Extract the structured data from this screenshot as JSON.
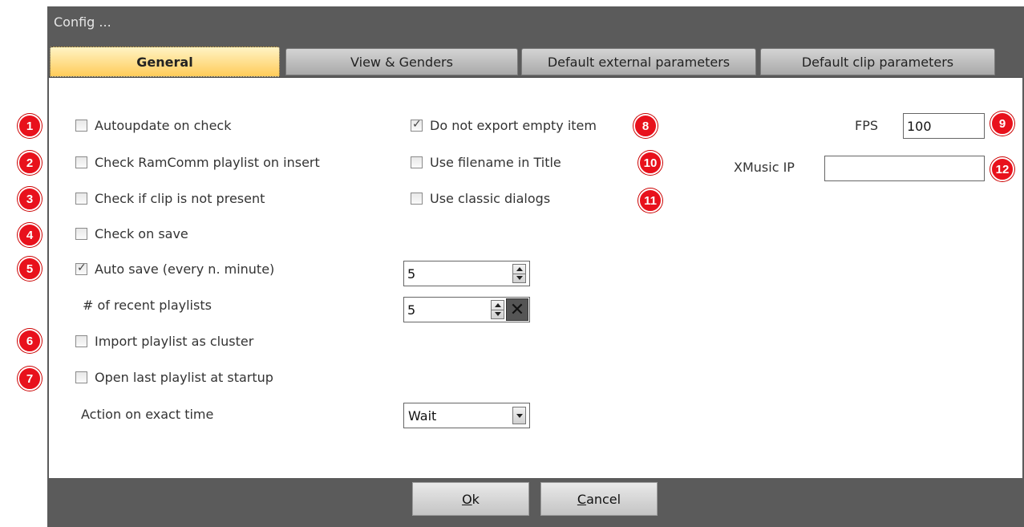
{
  "window": {
    "title": "Config ..."
  },
  "tabs": [
    {
      "label": "General",
      "active": true
    },
    {
      "label": "View & Genders",
      "active": false
    },
    {
      "label": "Default external parameters",
      "active": false
    },
    {
      "label": "Default clip parameters",
      "active": false
    }
  ],
  "general": {
    "autoupdate": {
      "label": "Autoupdate on check",
      "checked": false,
      "badge": "1"
    },
    "check_ramcomm": {
      "label": "Check RamComm playlist on insert",
      "checked": false,
      "badge": "2"
    },
    "check_clip": {
      "label": "Check if clip is not present",
      "checked": false,
      "badge": "3"
    },
    "check_save": {
      "label": "Check on save",
      "checked": false,
      "badge": "4"
    },
    "auto_save": {
      "label": "Auto save (every n. minute)",
      "checked": true,
      "badge": "5",
      "value": "5"
    },
    "recent_playlists": {
      "label": "# of recent playlists",
      "value": "5"
    },
    "import_cluster": {
      "label": "Import playlist as cluster",
      "checked": false,
      "badge": "6"
    },
    "open_last": {
      "label": "Open last playlist at startup",
      "checked": false,
      "badge": "7"
    },
    "action_exact_time": {
      "label": "Action on exact time",
      "value": "Wait"
    },
    "no_export_empty": {
      "label": "Do not export empty item",
      "checked": true,
      "badge": "8"
    },
    "filename_title": {
      "label": "Use filename in Title",
      "checked": false,
      "badge": "10"
    },
    "classic_dialogs": {
      "label": "Use classic dialogs",
      "checked": false,
      "badge": "11"
    },
    "fps": {
      "label": "FPS",
      "value": "100",
      "badge": "9"
    },
    "xmusic_ip": {
      "label": "XMusic IP",
      "value": "",
      "badge": "12"
    }
  },
  "footer": {
    "ok_prefix": "O",
    "ok_rest": "k",
    "cancel_prefix": "C",
    "cancel_rest": "ancel"
  },
  "colors": {
    "badge": "#e8111c",
    "active_tab": "#ffcc5a",
    "window_frame": "#5b5b5b"
  }
}
